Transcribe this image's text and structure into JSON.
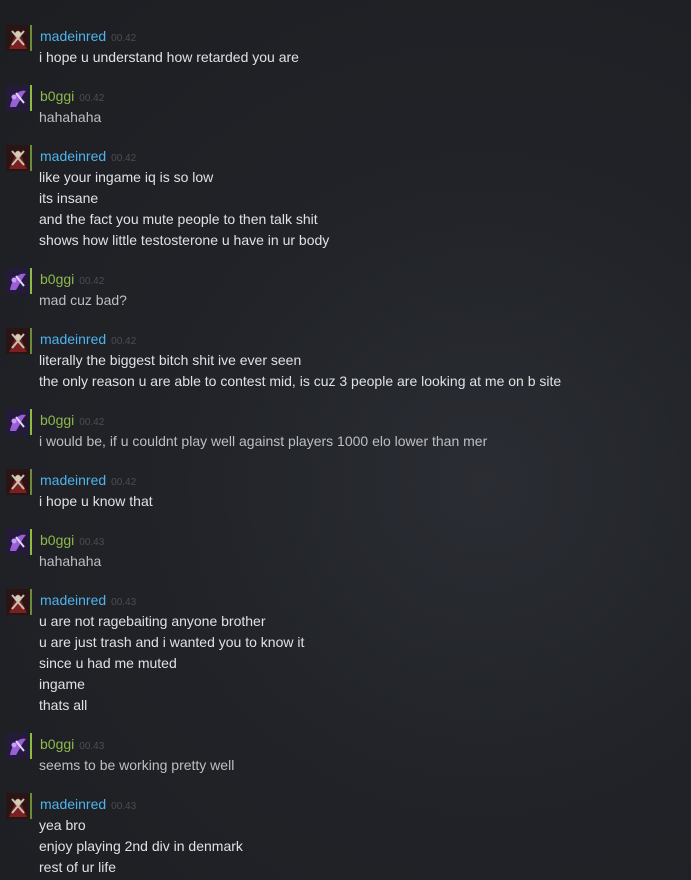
{
  "users": {
    "madeinred": {
      "name": "madeinred",
      "name_color": "#4fb3ee",
      "avatar_icon": "red-character-avatar-icon"
    },
    "b0ggi": {
      "name": "b0ggi",
      "name_color": "#8eb84c",
      "avatar_icon": "purple-character-avatar-icon"
    }
  },
  "messages": [
    {
      "user": "madeinred",
      "name": "madeinred",
      "time": "00.42",
      "lines": [
        "i hope u understand how retarded you are"
      ]
    },
    {
      "user": "b0ggi",
      "name": "b0ggi",
      "time": "00.42",
      "lines": [
        "hahahaha"
      ]
    },
    {
      "user": "madeinred",
      "name": "madeinred",
      "time": "00.42",
      "lines": [
        "like your ingame iq is so low",
        "its insane",
        "and the fact you mute people to then talk shit",
        "shows how little testosterone u have in ur body"
      ]
    },
    {
      "user": "b0ggi",
      "name": "b0ggi",
      "time": "00.42",
      "lines": [
        "mad cuz bad?"
      ]
    },
    {
      "user": "madeinred",
      "name": "madeinred",
      "time": "00.42",
      "lines": [
        "literally the biggest bitch shit ive ever seen",
        "the only reason u are able to contest mid, is cuz 3 people are looking at me on b site"
      ]
    },
    {
      "user": "b0ggi",
      "name": "b0ggi",
      "time": "00.42",
      "lines": [
        "i would be, if u couldnt play well against players 1000 elo lower than mer"
      ]
    },
    {
      "user": "madeinred",
      "name": "madeinred",
      "time": "00.42",
      "lines": [
        "i hope u know that"
      ]
    },
    {
      "user": "b0ggi",
      "name": "b0ggi",
      "time": "00.43",
      "lines": [
        "hahahaha"
      ]
    },
    {
      "user": "madeinred",
      "name": "madeinred",
      "time": "00.43",
      "lines": [
        "u are not ragebaiting anyone brother",
        "u are just trash and i wanted you to know it",
        "since u had me muted",
        "ingame",
        "thats all"
      ]
    },
    {
      "user": "b0ggi",
      "name": "b0ggi",
      "time": "00.43",
      "lines": [
        "seems to be working pretty well"
      ]
    },
    {
      "user": "madeinred",
      "name": "madeinred",
      "time": "00.43",
      "lines": [
        "yea bro",
        "enjoy playing 2nd div in denmark",
        "rest of ur life"
      ]
    }
  ]
}
